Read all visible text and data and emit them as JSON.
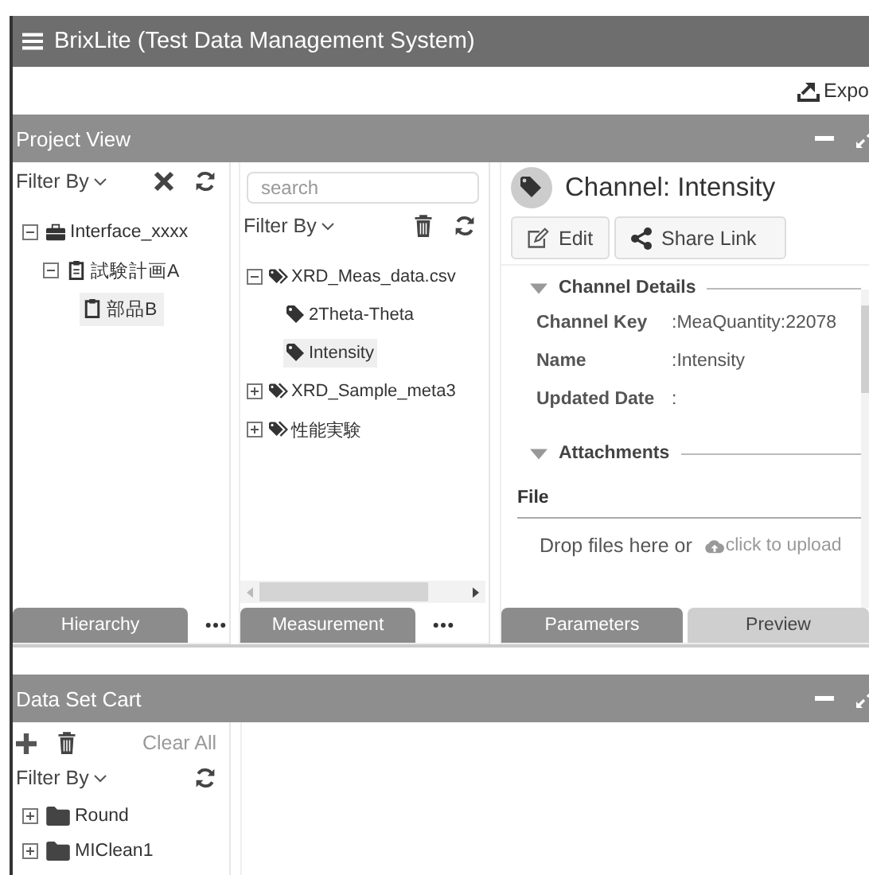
{
  "app": {
    "title": "BrixLite (Test Data Management System)"
  },
  "toolbar": {
    "export_label": "Expo"
  },
  "project_view": {
    "title": "Project View",
    "hierarchy": {
      "filter_label": "Filter By",
      "tree": [
        {
          "label": "Interface_xxxx",
          "kind": "project",
          "expanded": true,
          "selected": false,
          "children": [
            {
              "label": "試験計画A",
              "kind": "plan",
              "expanded": true,
              "selected": false,
              "children": [
                {
                  "label": "部品B",
                  "kind": "part",
                  "selected": true
                }
              ]
            }
          ]
        }
      ],
      "tab": {
        "label": "Hierarchy",
        "selected": true
      }
    },
    "measurement": {
      "search_placeholder": "search",
      "filter_label": "Filter By",
      "tree": [
        {
          "label": "XRD_Meas_data.csv",
          "kind": "file",
          "expanded": true,
          "selected": false,
          "children": [
            {
              "label": "2Theta-Theta",
              "kind": "channel",
              "selected": false
            },
            {
              "label": "Intensity",
              "kind": "channel",
              "selected": true
            }
          ]
        },
        {
          "label": "XRD_Sample_meta3",
          "kind": "file",
          "expanded": false,
          "selected": false
        },
        {
          "label": "性能実験",
          "kind": "file",
          "expanded": false,
          "selected": false
        }
      ],
      "tab": {
        "label": "Measurement",
        "selected": true
      }
    },
    "detail": {
      "title": "Channel: Intensity",
      "buttons": [
        "Edit",
        "Share Link"
      ],
      "sections": [
        {
          "title": "Channel Details",
          "expanded": true,
          "fields": [
            {
              "label": "Channel Key",
              "value": ":MeaQuantity:22078"
            },
            {
              "label": "Name",
              "value": ":Intensity"
            },
            {
              "label": "Updated Date",
              "value": ":"
            }
          ]
        },
        {
          "title": "Attachments",
          "expanded": true,
          "file_heading": "File",
          "drop_text": "Drop files here or",
          "upload_link": "click to upload"
        }
      ],
      "tabs": [
        {
          "label": "Parameters",
          "selected": true
        },
        {
          "label": "Preview",
          "selected": false
        }
      ]
    }
  },
  "cart": {
    "title": "Data Set Cart",
    "clear_label": "Clear All",
    "filter_label": "Filter By",
    "tree": [
      {
        "label": "Round",
        "kind": "folder",
        "expanded": false,
        "selected": false
      },
      {
        "label": "MIClean1",
        "kind": "folder",
        "expanded": false,
        "selected": false
      }
    ]
  }
}
